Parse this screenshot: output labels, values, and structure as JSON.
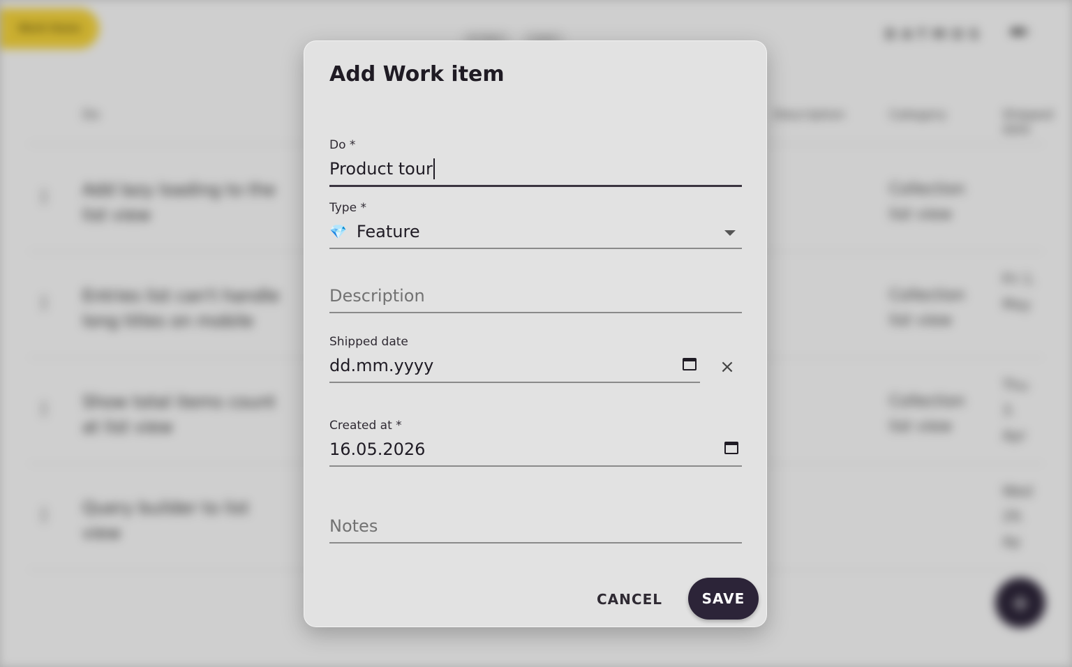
{
  "background": {
    "chip_label": "Work Items",
    "pills": [
      "In Dev",
      "Later"
    ],
    "brand": "DATMOS",
    "columns": [
      "Do",
      "Description",
      "Category",
      "Shipped date"
    ],
    "rows": [
      {
        "title": "Add lazy loading to the list view",
        "category": "Collection list view",
        "date": ""
      },
      {
        "title": "Entries list can't handle long titles on mobile",
        "category": "Collection list view",
        "date": "Fri 1. May"
      },
      {
        "title": "Show total items count at list view",
        "category": "Collection list view",
        "date": "Thu 3. Apr"
      },
      {
        "title": "Query builder to list view",
        "category": "",
        "date": "Wed 29. Ap"
      }
    ],
    "fab_label": "+"
  },
  "dialog": {
    "title": "Add Work item",
    "do": {
      "label": "Do *",
      "value": "Product tour"
    },
    "type": {
      "label": "Type *",
      "value": "Feature",
      "icon": "gem-icon"
    },
    "description": {
      "placeholder": "Description"
    },
    "shipped_date": {
      "label": "Shipped date",
      "value": "dd.mm.yyyy"
    },
    "created_at": {
      "label": "Created at *",
      "value": "16.05.2026"
    },
    "notes": {
      "placeholder": "Notes"
    },
    "cancel_label": "CANCEL",
    "save_label": "SAVE",
    "clear_glyph": "×"
  },
  "colors": {
    "accent": "#2c2438",
    "chip": "#f2d13a",
    "dialog_bg": "#e2e2e2"
  }
}
